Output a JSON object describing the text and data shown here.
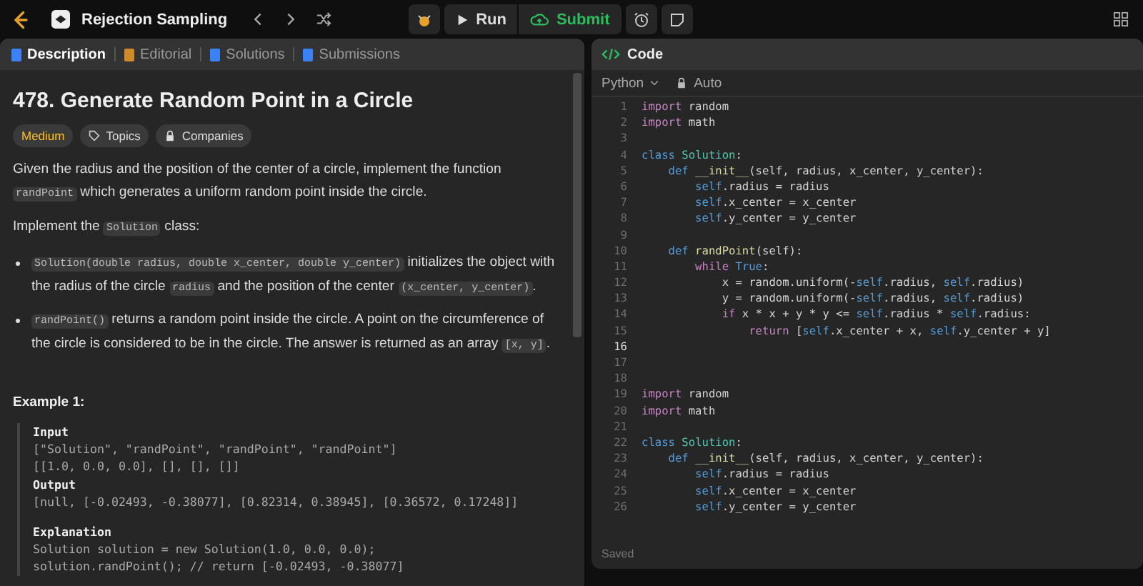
{
  "topbar": {
    "title": "Rejection Sampling",
    "run": "Run",
    "submit": "Submit"
  },
  "tabs": [
    {
      "label": "Description",
      "selected": true
    },
    {
      "label": "Editorial",
      "selected": false
    },
    {
      "label": "Solutions",
      "selected": false
    },
    {
      "label": "Submissions",
      "selected": false
    }
  ],
  "problem": {
    "title": "478. Generate Random Point in a Circle",
    "difficulty": "Medium",
    "topics": "Topics",
    "companies": "Companies",
    "paragraphs": [
      {
        "kind": "para",
        "parts": [
          {
            "kind": "text",
            "t": "Given the radius and the position of the center of a circle, implement the function "
          },
          {
            "kind": "code",
            "t": "randPoint"
          },
          {
            "kind": "text",
            "t": " which generates a uniform random point inside the circle."
          }
        ]
      },
      {
        "kind": "para",
        "parts": [
          {
            "kind": "text",
            "t": "Implement the "
          },
          {
            "kind": "code",
            "t": "Solution"
          },
          {
            "kind": "text",
            "t": " class:"
          }
        ]
      },
      {
        "kind": "bullet",
        "parts": [
          {
            "kind": "code",
            "t": "Solution(double radius, double x_center, double y_center)"
          },
          {
            "kind": "text",
            "t": " initializes the object with the radius of the circle "
          },
          {
            "kind": "code",
            "t": "radius"
          },
          {
            "kind": "text",
            "t": " and the position of the center "
          },
          {
            "kind": "code",
            "t": "(x_center, y_center)"
          },
          {
            "kind": "text",
            "t": "."
          }
        ]
      },
      {
        "kind": "bullet",
        "parts": [
          {
            "kind": "code",
            "t": "randPoint()"
          },
          {
            "kind": "text",
            "t": " returns a random point inside the circle. A point on the circumference of the circle is considered to be in the circle. The answer is returned as an array "
          },
          {
            "kind": "code",
            "t": "[x, y]"
          },
          {
            "kind": "text",
            "t": "."
          }
        ]
      }
    ],
    "example_title": "Example 1:",
    "example": [
      {
        "kind": "head",
        "t": "Input"
      },
      {
        "kind": "line",
        "t": "[\"Solution\", \"randPoint\", \"randPoint\", \"randPoint\"]"
      },
      {
        "kind": "line",
        "t": "[[1.0, 0.0, 0.0], [], [], []]"
      },
      {
        "kind": "head",
        "t": "Output"
      },
      {
        "kind": "line",
        "t": "[null, [-0.02493, -0.38077], [0.82314, 0.38945], [0.36572, 0.17248]]"
      },
      {
        "kind": "gap"
      },
      {
        "kind": "head",
        "t": "Explanation"
      },
      {
        "kind": "line",
        "t": "Solution solution = new Solution(1.0, 0.0, 0.0);"
      },
      {
        "kind": "line",
        "t": "solution.randPoint(); // return [-0.02493, -0.38077]"
      }
    ]
  },
  "code": {
    "title": "Code",
    "language": "Python",
    "mode": "Auto",
    "status": "Saved",
    "lines": [
      {
        "n": "1",
        "active": false,
        "parts": [
          {
            "kind": "kw",
            "t": "import"
          },
          {
            "kind": "id",
            "t": " random"
          }
        ]
      },
      {
        "n": "2",
        "active": false,
        "parts": [
          {
            "kind": "kw",
            "t": "import"
          },
          {
            "kind": "id",
            "t": " math"
          }
        ]
      },
      {
        "n": "3",
        "active": false
      },
      {
        "n": "4",
        "active": false,
        "parts": [
          {
            "kind": "def",
            "t": "class"
          },
          {
            "kind": "cls",
            "t": " Solution"
          },
          {
            "kind": "id",
            "t": ":"
          }
        ]
      },
      {
        "n": "5",
        "active": false,
        "parts": [
          {
            "kind": "def",
            "t": "    def"
          },
          {
            "kind": "fn",
            "t": " __init__"
          },
          {
            "kind": "id",
            "t": "(self, radius, x_center, y_center):"
          }
        ]
      },
      {
        "n": "6",
        "active": false,
        "parts": [
          {
            "kind": "self",
            "t": "        self"
          },
          {
            "kind": "id",
            "t": ".radius = radius"
          }
        ]
      },
      {
        "n": "7",
        "active": false,
        "parts": [
          {
            "kind": "self",
            "t": "        self"
          },
          {
            "kind": "id",
            "t": ".x_center = x_center"
          }
        ]
      },
      {
        "n": "8",
        "active": false,
        "parts": [
          {
            "kind": "self",
            "t": "        self"
          },
          {
            "kind": "id",
            "t": ".y_center = y_center"
          }
        ]
      },
      {
        "n": "9",
        "active": false
      },
      {
        "n": "10",
        "active": false,
        "parts": [
          {
            "kind": "def",
            "t": "    def"
          },
          {
            "kind": "fn",
            "t": " randPoint"
          },
          {
            "kind": "id",
            "t": "(self):"
          }
        ]
      },
      {
        "n": "11",
        "active": false,
        "parts": [
          {
            "kind": "kw",
            "t": "        while"
          },
          {
            "kind": "def",
            "t": " True"
          },
          {
            "kind": "id",
            "t": ":"
          }
        ]
      },
      {
        "n": "12",
        "active": false,
        "parts": [
          {
            "kind": "id",
            "t": "            x = random.uniform(-"
          },
          {
            "kind": "self",
            "t": "self"
          },
          {
            "kind": "id",
            "t": ".radius, "
          },
          {
            "kind": "self",
            "t": "self"
          },
          {
            "kind": "id",
            "t": ".radius)"
          }
        ]
      },
      {
        "n": "13",
        "active": false,
        "parts": [
          {
            "kind": "id",
            "t": "            y = random.uniform(-"
          },
          {
            "kind": "self",
            "t": "self"
          },
          {
            "kind": "id",
            "t": ".radius, "
          },
          {
            "kind": "self",
            "t": "self"
          },
          {
            "kind": "id",
            "t": ".radius)"
          }
        ]
      },
      {
        "n": "14",
        "active": false,
        "parts": [
          {
            "kind": "kw",
            "t": "            if"
          },
          {
            "kind": "id",
            "t": " x * x + y * y <= "
          },
          {
            "kind": "self",
            "t": "self"
          },
          {
            "kind": "id",
            "t": ".radius * "
          },
          {
            "kind": "self",
            "t": "self"
          },
          {
            "kind": "id",
            "t": ".radius:"
          }
        ]
      },
      {
        "n": "15",
        "active": false,
        "parts": [
          {
            "kind": "kw",
            "t": "                return"
          },
          {
            "kind": "id",
            "t": " ["
          },
          {
            "kind": "self",
            "t": "self"
          },
          {
            "kind": "id",
            "t": ".x_center + x, "
          },
          {
            "kind": "self",
            "t": "self"
          },
          {
            "kind": "id",
            "t": ".y_center + y]"
          }
        ]
      },
      {
        "n": "16",
        "active": true
      },
      {
        "n": "17",
        "active": false
      },
      {
        "n": "18",
        "active": false
      },
      {
        "n": "19",
        "active": false,
        "parts": [
          {
            "kind": "kw",
            "t": "import"
          },
          {
            "kind": "id",
            "t": " random"
          }
        ]
      },
      {
        "n": "20",
        "active": false,
        "parts": [
          {
            "kind": "kw",
            "t": "import"
          },
          {
            "kind": "id",
            "t": " math"
          }
        ]
      },
      {
        "n": "21",
        "active": false
      },
      {
        "n": "22",
        "active": false,
        "parts": [
          {
            "kind": "def",
            "t": "class"
          },
          {
            "kind": "cls",
            "t": " Solution"
          },
          {
            "kind": "id",
            "t": ":"
          }
        ]
      },
      {
        "n": "23",
        "active": false,
        "parts": [
          {
            "kind": "def",
            "t": "    def"
          },
          {
            "kind": "fn",
            "t": " __init__"
          },
          {
            "kind": "id",
            "t": "(self, radius, x_center, y_center):"
          }
        ]
      },
      {
        "n": "24",
        "active": false,
        "parts": [
          {
            "kind": "self",
            "t": "        self"
          },
          {
            "kind": "id",
            "t": ".radius = radius"
          }
        ]
      },
      {
        "n": "25",
        "active": false,
        "parts": [
          {
            "kind": "self",
            "t": "        self"
          },
          {
            "kind": "id",
            "t": ".x_center = x_center"
          }
        ]
      },
      {
        "n": "26",
        "active": false,
        "parts": [
          {
            "kind": "self",
            "t": "        self"
          },
          {
            "kind": "id",
            "t": ".y_center = y_center"
          }
        ]
      }
    ]
  }
}
